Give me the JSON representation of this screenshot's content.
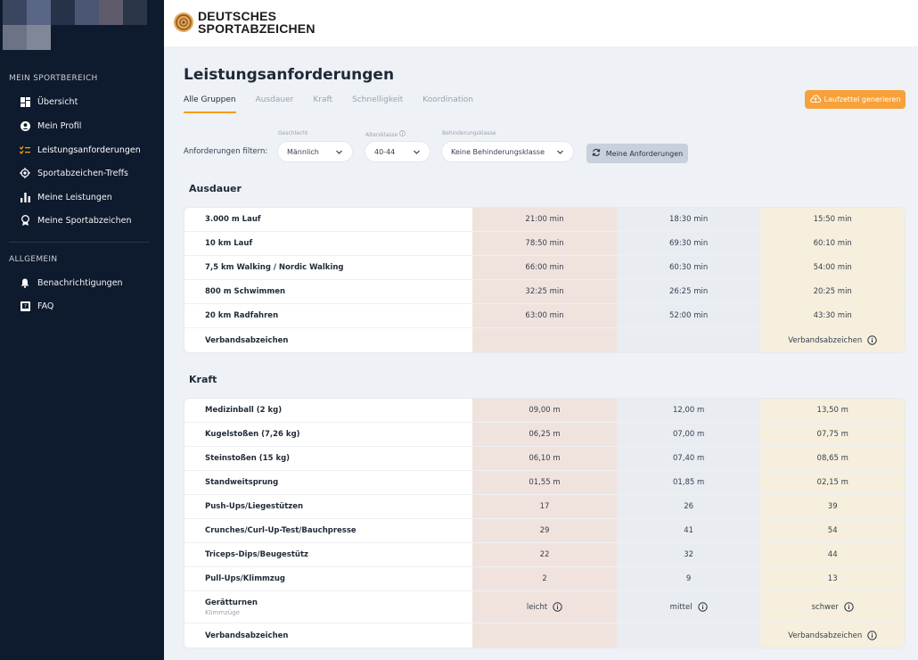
{
  "app": {
    "logo_line1": "DEUTSCHES",
    "logo_line2": "SPORTABZEICHEN",
    "accent_color": "#f7a13a"
  },
  "sidebar": {
    "section1": "MEIN SPORTBEREICH",
    "section2": "ALLGEMEIN",
    "items": [
      {
        "label": "Übersicht",
        "icon": "dashboard-icon"
      },
      {
        "label": "Mein Profil",
        "icon": "user-circle-icon"
      },
      {
        "label": "Leistungsanforderungen",
        "icon": "requirements-icon",
        "active": true
      },
      {
        "label": "Sportabzeichen-Treffs",
        "icon": "location-target-icon"
      },
      {
        "label": "Meine Leistungen",
        "icon": "bar-chart-icon"
      },
      {
        "label": "Meine Sportabzeichen",
        "icon": "medal-icon"
      }
    ],
    "items2": [
      {
        "label": "Benachrichtigungen",
        "icon": "bell-icon"
      },
      {
        "label": "FAQ",
        "icon": "faq-book-icon"
      }
    ]
  },
  "page": {
    "title": "Leistungsanforderungen",
    "tabs": [
      "Alle Gruppen",
      "Ausdauer",
      "Kraft",
      "Schnelligkeit",
      "Koordination"
    ],
    "generate_button": "Laufzettel generieren"
  },
  "filters": {
    "label": "Anforderungen filtern:",
    "gender_caption": "Geschlecht",
    "gender_value": "Männlich",
    "age_caption": "Altersklasse",
    "age_value": "40-44",
    "disability_caption": "Behinderungsklasse",
    "disability_value": "Keine Behinderungsklasse",
    "my_requirements_button": "Meine Anforderungen"
  },
  "ausdauer": {
    "title": "Ausdauer",
    "rows": [
      {
        "name": "3.000 m Lauf",
        "bronze": "21:00 min",
        "silver": "18:30 min",
        "gold": "15:50 min"
      },
      {
        "name": "10 km Lauf",
        "bronze": "78:50 min",
        "silver": "69:30 min",
        "gold": "60:10 min"
      },
      {
        "name": "7,5 km Walking / Nordic Walking",
        "bronze": "66:00 min",
        "silver": "60:30 min",
        "gold": "54:00 min"
      },
      {
        "name": "800 m Schwimmen",
        "bronze": "32:25 min",
        "silver": "26:25 min",
        "gold": "20:25 min"
      },
      {
        "name": "20 km Radfahren",
        "bronze": "63:00 min",
        "silver": "52:00 min",
        "gold": "43:30 min"
      },
      {
        "name": "Verbandsabzeichen",
        "bronze": "",
        "silver": "",
        "gold": "Verbandsabzeichen"
      }
    ]
  },
  "kraft": {
    "title": "Kraft",
    "rows": [
      {
        "name": "Medizinball (2 kg)",
        "bronze": "09,00 m",
        "silver": "12,00 m",
        "gold": "13,50 m"
      },
      {
        "name": "Kugelstoßen (7,26 kg)",
        "bronze": "06,25 m",
        "silver": "07,00 m",
        "gold": "07,75 m"
      },
      {
        "name": "Steinstoßen (15 kg)",
        "bronze": "06,10 m",
        "silver": "07,40 m",
        "gold": "08,65 m"
      },
      {
        "name": "Standweitsprung",
        "bronze": "01,55 m",
        "silver": "01,85 m",
        "gold": "02,15 m"
      },
      {
        "name": "Push-Ups/Liegestützen",
        "bronze": "17",
        "silver": "26",
        "gold": "39"
      },
      {
        "name": "Crunches/Curl-Up-Test/Bauchpresse",
        "bronze": "29",
        "silver": "41",
        "gold": "54"
      },
      {
        "name": "Triceps-Dips/Beugestütz",
        "bronze": "22",
        "silver": "32",
        "gold": "44"
      },
      {
        "name": "Pull-Ups/Klimmzug",
        "bronze": "2",
        "silver": "9",
        "gold": "13"
      },
      {
        "name": "Gerätturnen",
        "sub": "Klimmzüge",
        "bronze": "leicht",
        "silver": "mittel",
        "gold": "schwer"
      },
      {
        "name": "Verbandsabzeichen",
        "bronze": "",
        "silver": "",
        "gold": "Verbandsabzeichen"
      }
    ]
  }
}
